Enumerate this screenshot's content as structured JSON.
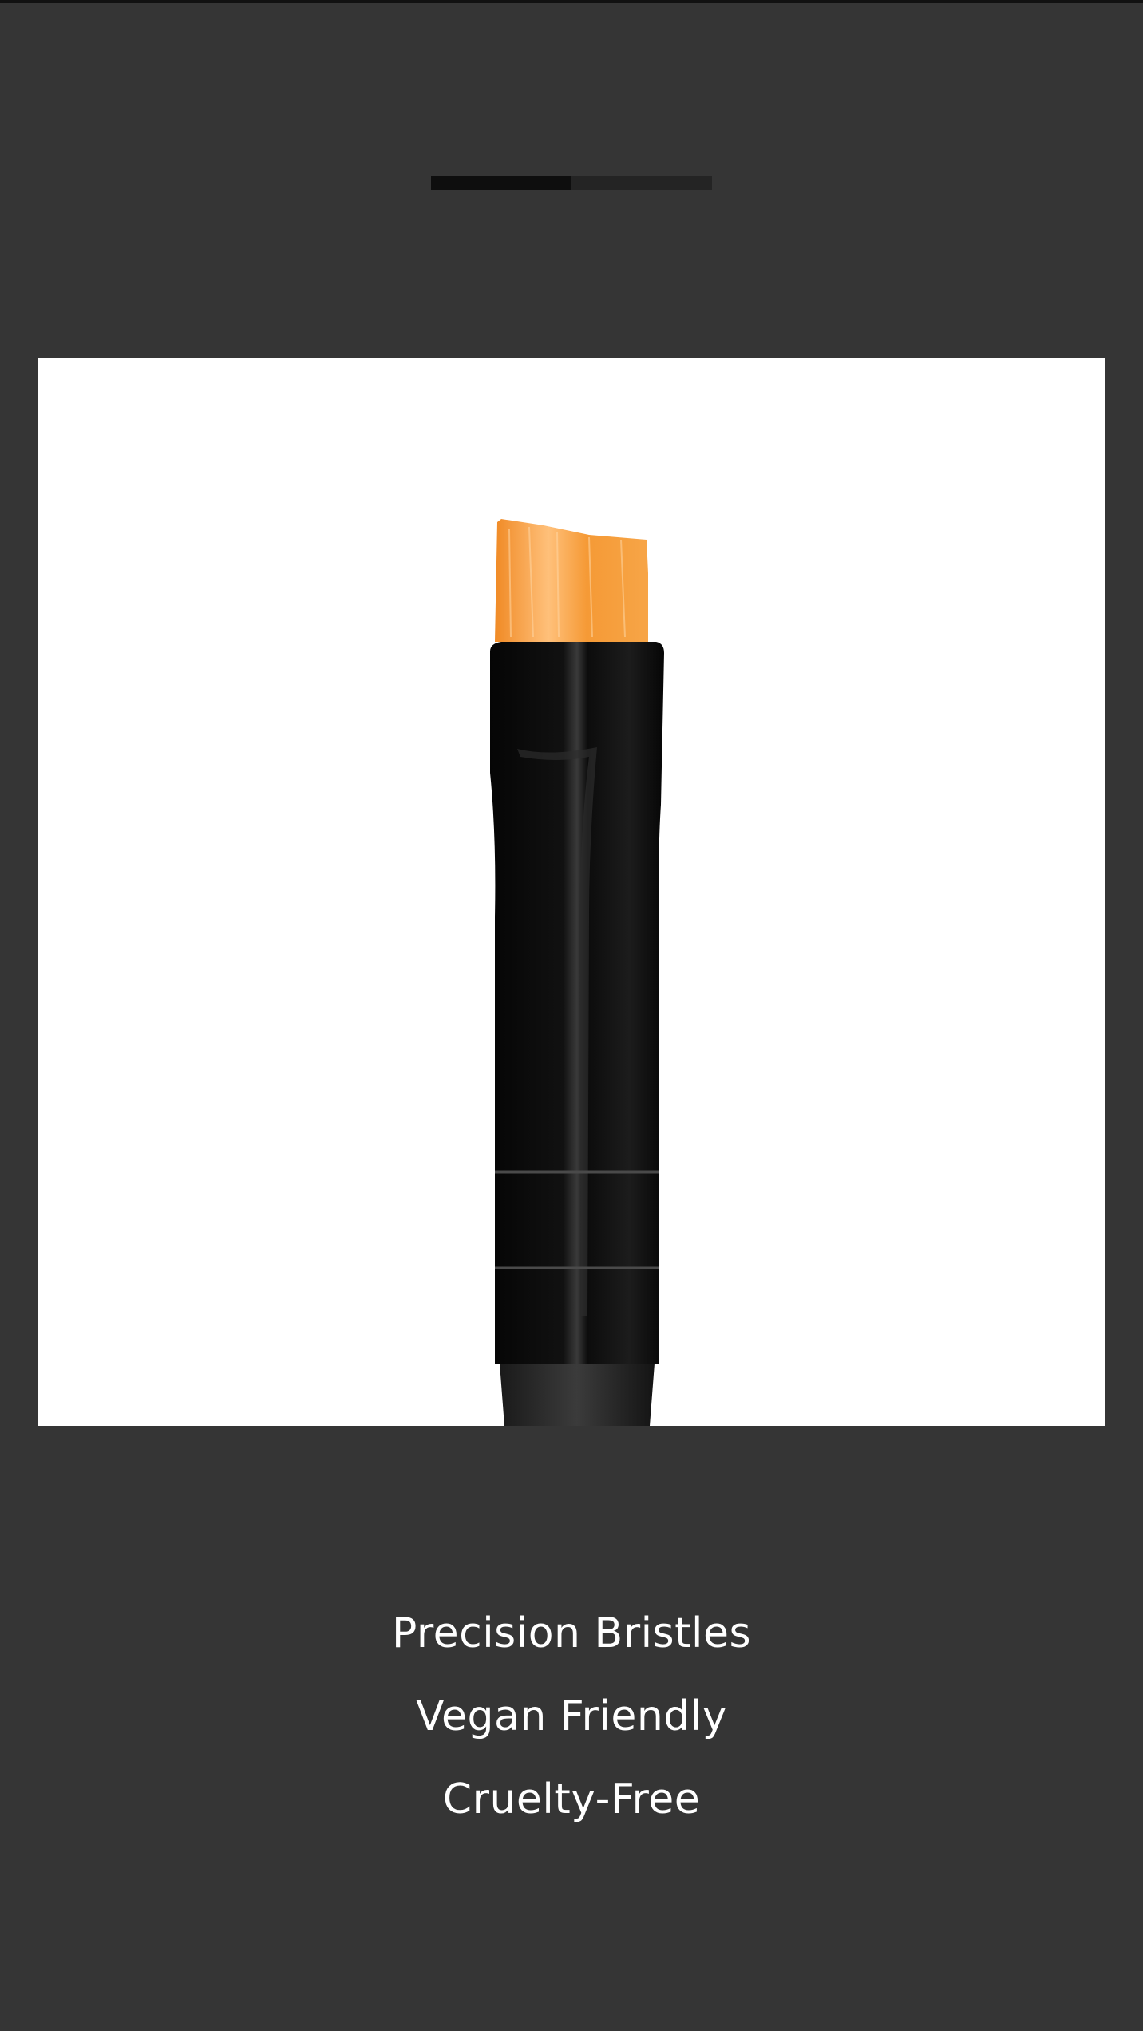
{
  "carousel": {
    "progress_fraction": 0.5,
    "image_icon": "makeup-brush-image"
  },
  "colors": {
    "background": "#353535",
    "progress_track": "#242424",
    "progress_fill": "#0e0e0e",
    "bristles": "#f39a3c",
    "handle": "#0a0a0a",
    "text": "#ffffff"
  },
  "features": [
    "Precision Bristles",
    "Vegan Friendly",
    "Cruelty-Free"
  ]
}
